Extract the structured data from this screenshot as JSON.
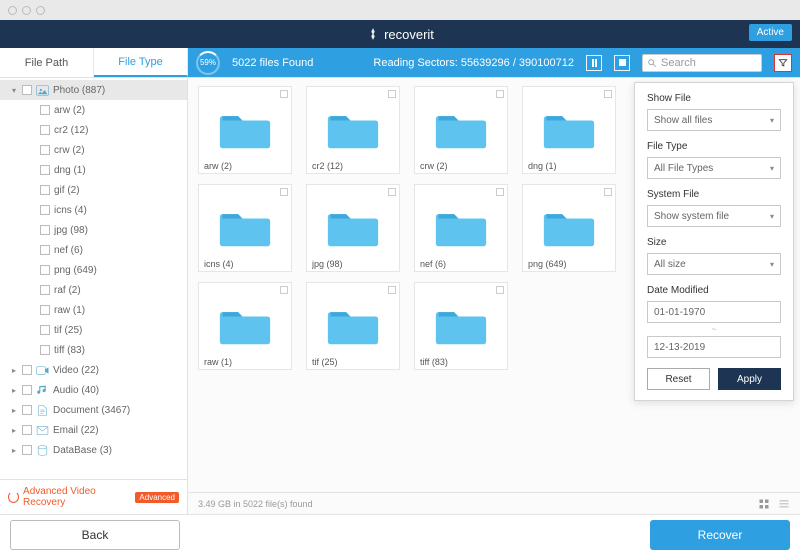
{
  "header": {
    "brand": "recoverit",
    "active": "Active"
  },
  "tabs": {
    "path": "File Path",
    "type": "File Type"
  },
  "scan": {
    "percent": "59%",
    "found": "5022 files Found",
    "reading": "Reading Sectors: 55639296 / 390100712",
    "search_placeholder": "Search"
  },
  "sidebar": {
    "categories": [
      {
        "label": "Photo (887)",
        "expanded": true,
        "icon": "photo",
        "children": [
          {
            "label": "arw (2)"
          },
          {
            "label": "cr2 (12)"
          },
          {
            "label": "crw (2)"
          },
          {
            "label": "dng (1)"
          },
          {
            "label": "gif (2)"
          },
          {
            "label": "icns (4)"
          },
          {
            "label": "jpg (98)"
          },
          {
            "label": "nef (6)"
          },
          {
            "label": "png (649)"
          },
          {
            "label": "raf (2)"
          },
          {
            "label": "raw (1)"
          },
          {
            "label": "tif (25)"
          },
          {
            "label": "tiff (83)"
          }
        ]
      },
      {
        "label": "Video (22)",
        "icon": "video"
      },
      {
        "label": "Audio (40)",
        "icon": "audio"
      },
      {
        "label": "Document (3467)",
        "icon": "document"
      },
      {
        "label": "Email (22)",
        "icon": "email"
      },
      {
        "label": "DataBase (3)",
        "icon": "database"
      }
    ],
    "avr": "Advanced Video Recovery",
    "avr_badge": "Advanced"
  },
  "grid": {
    "folders": [
      {
        "label": "arw (2)"
      },
      {
        "label": "cr2 (12)"
      },
      {
        "label": "crw (2)"
      },
      {
        "label": "dng (1)"
      },
      {
        "label": "icns (4)"
      },
      {
        "label": "jpg (98)"
      },
      {
        "label": "nef (6)"
      },
      {
        "label": "png (649)"
      },
      {
        "label": "raw (1)"
      },
      {
        "label": "tif (25)"
      },
      {
        "label": "tiff (83)"
      }
    ]
  },
  "contentfoot": {
    "summary": "3.49 GB in 5022 file(s) found"
  },
  "filter": {
    "showfile_label": "Show File",
    "showfile_value": "Show all files",
    "filetype_label": "File Type",
    "filetype_value": "All File Types",
    "sysfile_label": "System File",
    "sysfile_value": "Show system file",
    "size_label": "Size",
    "size_value": "All size",
    "date_label": "Date Modified",
    "date_from": "01-01-1970",
    "date_sep": "~",
    "date_to": "12-13-2019",
    "reset": "Reset",
    "apply": "Apply"
  },
  "footer": {
    "back": "Back",
    "recover": "Recover"
  }
}
